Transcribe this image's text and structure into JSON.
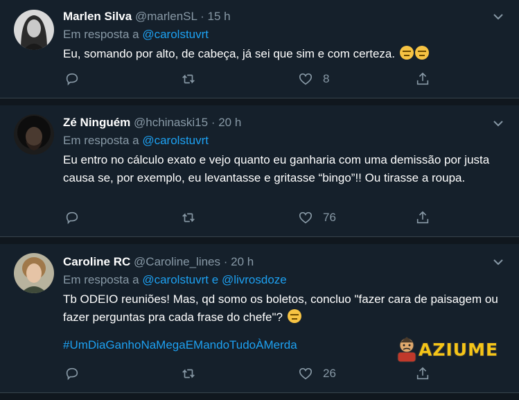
{
  "tweets": [
    {
      "name": "Marlen Silva",
      "handle": "@marlenSL",
      "dot": "·",
      "time": "15 h",
      "reply_prefix": "Em resposta a",
      "reply_to": "@carolstuvrt",
      "text": "Eu, somando por alto, de cabeça, já sei que sim e com certeza.",
      "like_count": "8"
    },
    {
      "name": "Zé Ninguém",
      "handle": "@hchinaski15",
      "dot": "·",
      "time": "20 h",
      "reply_prefix": "Em resposta a",
      "reply_to": "@carolstuvrt",
      "text": "Eu entro no cálculo exato e vejo quanto eu ganharia com uma demissão por justa causa se, por exemplo, eu levantasse e gritasse “bingo”!! Ou tirasse a roupa.",
      "like_count": "76"
    },
    {
      "name": "Caroline RC",
      "handle": "@Caroline_lines",
      "dot": "·",
      "time": "20 h",
      "reply_prefix": "Em resposta a",
      "reply_to": "@carolstuvrt",
      "reply_and": "e",
      "reply_to_2": "@livrosdoze",
      "text": "Tb ODEIO reuniões! Mas, qd somo os boletos, concluo \"fazer cara de paisagem ou fazer perguntas pra cada frase do chefe\"?",
      "hashtag": "#UmDiaGanhoNaMegaEMandoTudoÀMerda",
      "like_count": "26"
    }
  ],
  "watermark": {
    "text": "AZIUME"
  },
  "colors": {
    "background": "#15202b",
    "separator": "#10171e",
    "muted": "#8899a6",
    "link": "#1da1f2",
    "watermark": "#f5c518"
  },
  "icons": [
    "reply-icon",
    "retweet-icon",
    "like-icon",
    "share-icon",
    "chevron-down-icon",
    "neutral-face-emoji"
  ]
}
